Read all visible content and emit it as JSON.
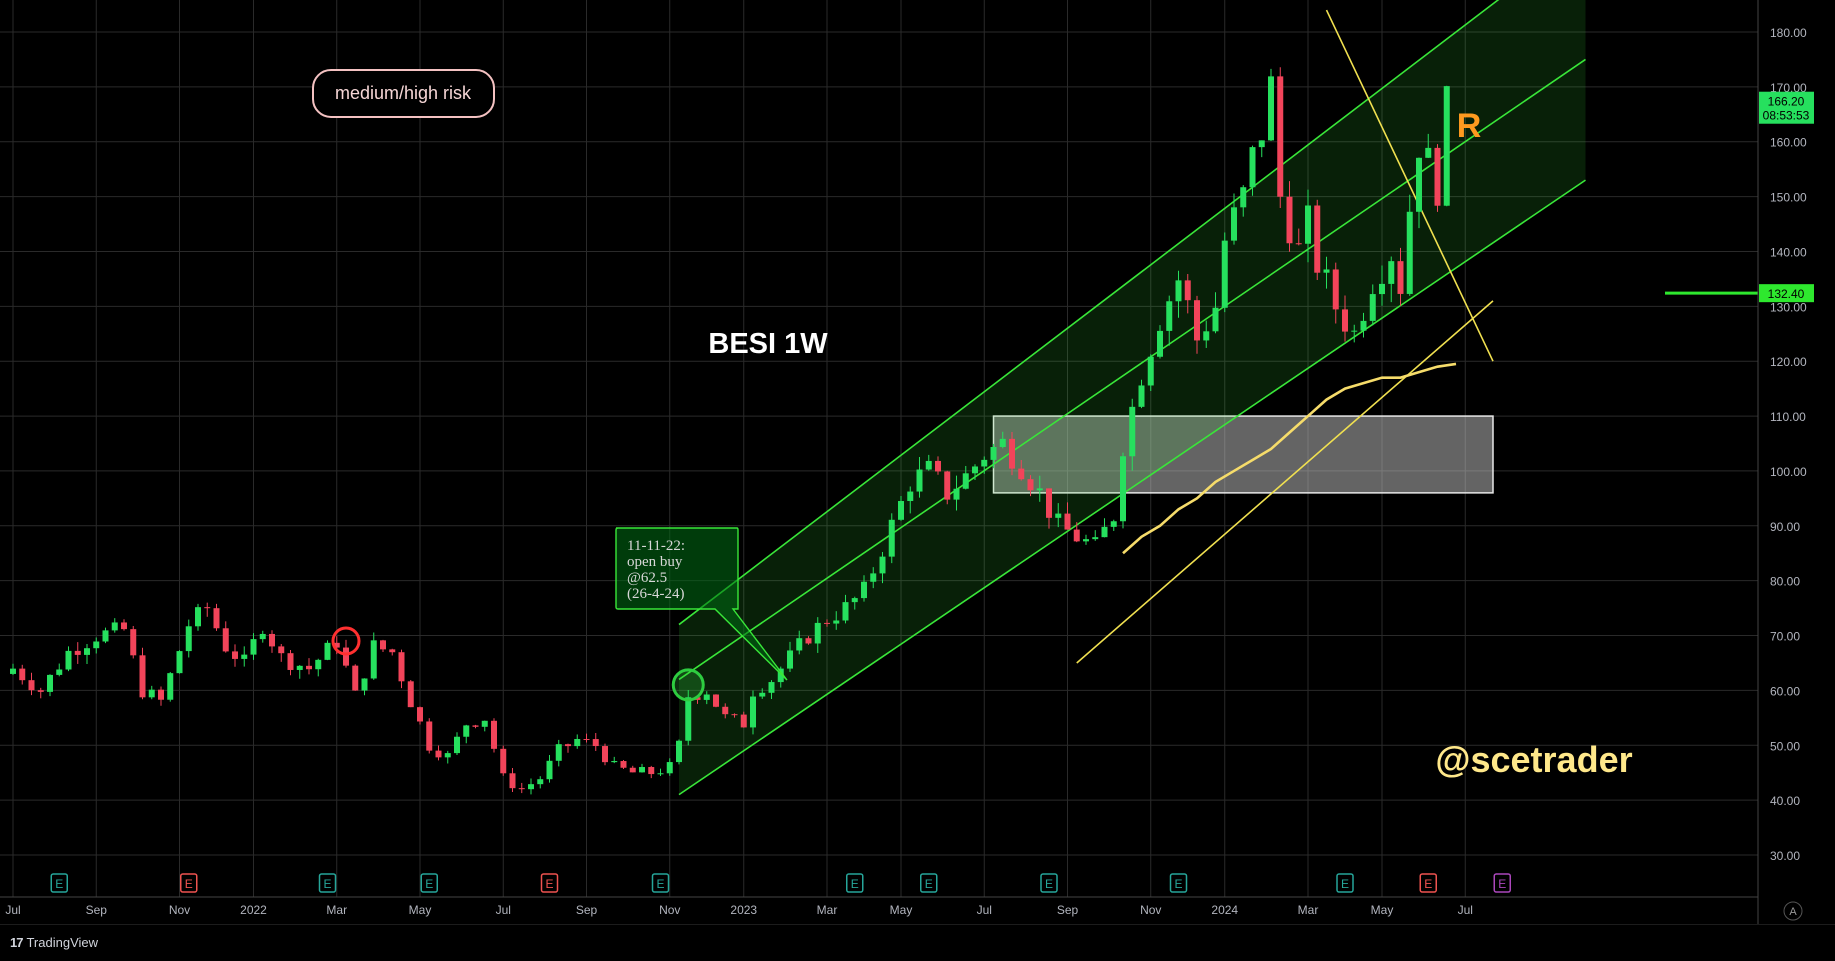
{
  "chart_data": {
    "type": "candlestick",
    "symbol_title": "BESI 1W",
    "y_ticks": [
      30,
      40,
      50,
      60,
      70,
      80,
      90,
      100,
      110,
      120,
      130,
      140,
      150,
      160,
      170,
      180
    ],
    "y_tick_labels": [
      "30.00",
      "40.00",
      "50.00",
      "60.00",
      "70.00",
      "80.00",
      "90.00",
      "100.00",
      "110.00",
      "120.00",
      "130.00",
      "140.00",
      "150.00",
      "160.00",
      "170.00",
      "180.00"
    ],
    "ylim": [
      22,
      186
    ],
    "x_ticks": [
      {
        "label": "Jul",
        "week": 0
      },
      {
        "label": "Sep",
        "week": 9
      },
      {
        "label": "Nov",
        "week": 18
      },
      {
        "label": "2022",
        "week": 26
      },
      {
        "label": "Mar",
        "week": 35
      },
      {
        "label": "May",
        "week": 44
      },
      {
        "label": "Jul",
        "week": 53
      },
      {
        "label": "Sep",
        "week": 62
      },
      {
        "label": "Nov",
        "week": 71
      },
      {
        "label": "2023",
        "week": 79
      },
      {
        "label": "Mar",
        "week": 88
      },
      {
        "label": "May",
        "week": 96
      },
      {
        "label": "Jul",
        "week": 105
      },
      {
        "label": "Sep",
        "week": 114
      },
      {
        "label": "Nov",
        "week": 123
      },
      {
        "label": "2024",
        "week": 131
      },
      {
        "label": "Mar",
        "week": 140
      },
      {
        "label": "May",
        "week": 148
      },
      {
        "label": "Jul",
        "week": 157
      }
    ],
    "close_anchors": [
      [
        0,
        64
      ],
      [
        3,
        60
      ],
      [
        6,
        67
      ],
      [
        9,
        70
      ],
      [
        12,
        71
      ],
      [
        14,
        60
      ],
      [
        16,
        58
      ],
      [
        19,
        72
      ],
      [
        21,
        75
      ],
      [
        23,
        68
      ],
      [
        25,
        65
      ],
      [
        27,
        72
      ],
      [
        29,
        66
      ],
      [
        32,
        64
      ],
      [
        35,
        69
      ],
      [
        37,
        59
      ],
      [
        39,
        68
      ],
      [
        41,
        67
      ],
      [
        43,
        58
      ],
      [
        45,
        50
      ],
      [
        47,
        48
      ],
      [
        49,
        54
      ],
      [
        51,
        55
      ],
      [
        53,
        44
      ],
      [
        55,
        42
      ],
      [
        57,
        44
      ],
      [
        59,
        49
      ],
      [
        61,
        51
      ],
      [
        63,
        50
      ],
      [
        65,
        46
      ],
      [
        67,
        45
      ],
      [
        69,
        45
      ],
      [
        71,
        46
      ],
      [
        72,
        50
      ],
      [
        73,
        59
      ],
      [
        75,
        60
      ],
      [
        77,
        55
      ],
      [
        79,
        54
      ],
      [
        80,
        60
      ],
      [
        82,
        62
      ],
      [
        84,
        66
      ],
      [
        86,
        70
      ],
      [
        88,
        73
      ],
      [
        90,
        75
      ],
      [
        92,
        78
      ],
      [
        93,
        82
      ],
      [
        95,
        90
      ],
      [
        97,
        98
      ],
      [
        99,
        100
      ],
      [
        101,
        96
      ],
      [
        103,
        99
      ],
      [
        105,
        103
      ],
      [
        107,
        105
      ],
      [
        109,
        101
      ],
      [
        111,
        96
      ],
      [
        113,
        90
      ],
      [
        115,
        88
      ],
      [
        117,
        86
      ],
      [
        119,
        92
      ],
      [
        120,
        105
      ],
      [
        122,
        118
      ],
      [
        124,
        128
      ],
      [
        126,
        135
      ],
      [
        127,
        130
      ],
      [
        128,
        124
      ],
      [
        130,
        130
      ],
      [
        131,
        142
      ],
      [
        133,
        150
      ],
      [
        134,
        157
      ],
      [
        135,
        162
      ],
      [
        136,
        170
      ],
      [
        137,
        150
      ],
      [
        139,
        140
      ],
      [
        140,
        145
      ],
      [
        141,
        138
      ],
      [
        143,
        130
      ],
      [
        145,
        125
      ],
      [
        147,
        135
      ],
      [
        149,
        140
      ],
      [
        150,
        134
      ],
      [
        151,
        148
      ],
      [
        152,
        160
      ],
      [
        154,
        152
      ],
      [
        155,
        166
      ]
    ],
    "last_price": "166.20",
    "countdown": "08:53:53",
    "level_price": "132.40",
    "level_value": 132.4,
    "demand_zone": {
      "week_start": 106,
      "week_end": 160,
      "y_low": 96,
      "y_high": 110
    },
    "channel_green": {
      "upper": [
        [
          72,
          72
        ],
        [
          170,
          198
        ]
      ],
      "lower": [
        [
          72,
          41
        ],
        [
          170,
          153
        ]
      ],
      "mid": [
        [
          72,
          62
        ],
        [
          170,
          175
        ]
      ]
    },
    "yellow_lines": {
      "support": [
        [
          115,
          65
        ],
        [
          160,
          131
        ]
      ],
      "resistance": [
        [
          142,
          184
        ],
        [
          160,
          120
        ]
      ]
    },
    "moving_average": [
      [
        120,
        85
      ],
      [
        122,
        88
      ],
      [
        124,
        90
      ],
      [
        126,
        93
      ],
      [
        128,
        95
      ],
      [
        130,
        98
      ],
      [
        132,
        100
      ],
      [
        134,
        102
      ],
      [
        136,
        104
      ],
      [
        138,
        107
      ],
      [
        140,
        110
      ],
      [
        142,
        113
      ],
      [
        144,
        115
      ],
      [
        146,
        116
      ],
      [
        148,
        117
      ],
      [
        150,
        117
      ],
      [
        152,
        118
      ],
      [
        154,
        119
      ],
      [
        156,
        119.5
      ]
    ],
    "signal_marker": {
      "week": 73,
      "value": 61,
      "color": "#2ecc40"
    },
    "red_marker": {
      "week": 36,
      "value": 69,
      "color": "#ff3030"
    },
    "callout_lines": [
      "11-11-22:",
      "open buy",
      "@62.5",
      "(26-4-24)"
    ],
    "risk_label": "medium/high risk",
    "r_label": "R",
    "watermark": "@scetrader",
    "event_markers": [
      {
        "week": 5,
        "type": "E",
        "color": "#26a69a"
      },
      {
        "week": 19,
        "type": "E",
        "color": "#ef5350"
      },
      {
        "week": 34,
        "type": "E",
        "color": "#26a69a"
      },
      {
        "week": 45,
        "type": "E",
        "color": "#26a69a"
      },
      {
        "week": 58,
        "type": "E",
        "color": "#ef5350"
      },
      {
        "week": 70,
        "type": "E",
        "color": "#26a69a"
      },
      {
        "week": 91,
        "type": "E",
        "color": "#26a69a"
      },
      {
        "week": 99,
        "type": "E",
        "color": "#26a69a"
      },
      {
        "week": 112,
        "type": "E",
        "color": "#26a69a"
      },
      {
        "week": 126,
        "type": "E",
        "color": "#26a69a"
      },
      {
        "week": 144,
        "type": "E",
        "color": "#26a69a"
      },
      {
        "week": 153,
        "type": "E",
        "color": "#ef5350"
      },
      {
        "week": 161,
        "type": "E",
        "color": "#ab47bc"
      }
    ],
    "grid": true,
    "colors": {
      "up": "#26e05e",
      "down": "#f2445a",
      "channel": "#39e639",
      "channel_fill": "rgba(57,230,57,0.14)",
      "yellow": "#f0e050",
      "ma": "#f6dc6a",
      "grid": "#2a2a2a",
      "axis_text": "#b2b5be"
    }
  },
  "axis_corner_label": "A",
  "brand": {
    "logo": "17",
    "name": "TradingView"
  }
}
